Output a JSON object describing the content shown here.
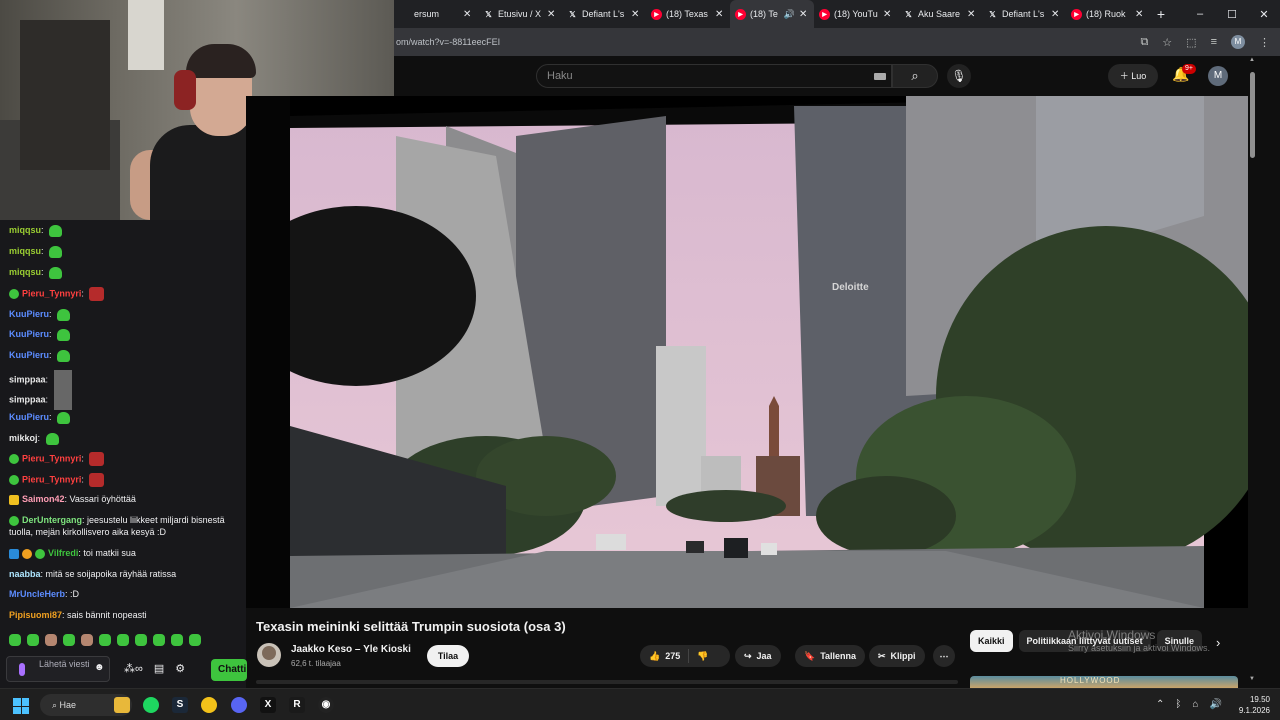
{
  "browser": {
    "tabs": [
      {
        "label": "ersum",
        "icon": "page-icon",
        "active": false
      },
      {
        "label": "Etusivu / X",
        "icon": "x-icon",
        "active": false
      },
      {
        "label": "Defiant L's",
        "icon": "x-icon",
        "active": false
      },
      {
        "label": "(18) Texas",
        "icon": "youtube-icon",
        "active": false
      },
      {
        "label": "(18) Te",
        "icon": "youtube-icon",
        "active": true
      },
      {
        "label": "(18) YouTu",
        "icon": "youtube-icon",
        "active": false
      },
      {
        "label": "Aku Saare",
        "icon": "x-icon",
        "active": false
      },
      {
        "label": "Defiant L's",
        "icon": "x-icon",
        "active": false
      },
      {
        "label": "(18) Ruok",
        "icon": "youtube-icon",
        "active": false
      }
    ],
    "new_tab": "+",
    "window_controls": [
      "–",
      "☐",
      "✕"
    ],
    "url": "om/watch?v=-8811eecFEI",
    "profile_initial": "M"
  },
  "youtube": {
    "search_placeholder": "Haku",
    "create_label": "Luo",
    "notifications_badge": "9+",
    "user_initial": "M",
    "video": {
      "title": "Texasin meininki selittää Trumpin suosiota (osa 3)",
      "overlay_text": "Deloitte",
      "bottom_text": "Aktivoi Windows"
    },
    "channel": {
      "name": "Jaakko Keso – Yle Kioski",
      "subscribers": "62,6 t. tilaajaa",
      "subscribe_label": "Tilaa"
    },
    "actions": {
      "likes": "275",
      "share": "Jaa",
      "save": "Tallenna",
      "clip": "Klippi"
    },
    "chips": [
      "Kaikki",
      "Politiikkaan liittyvät uutiset",
      "Sinulle"
    ],
    "thumbnail_text": "HOLLYWOOD"
  },
  "windows_watermark": {
    "line1": "Aktivoi Windows",
    "line2": "Siirry asetuksiin ja aktivoi Windows."
  },
  "chat": {
    "messages": [
      {
        "user": "miqqsu",
        "text": "",
        "color": "#9acd32"
      },
      {
        "user": "miqqsu",
        "text": "",
        "color": "#9acd32"
      },
      {
        "user": "miqqsu",
        "text": "",
        "color": "#9acd32"
      },
      {
        "user": "Pieru_Tynnyri",
        "text": "",
        "color": "#ff4040"
      },
      {
        "user": "KuuPieru",
        "text": "",
        "color": "#5c8cff"
      },
      {
        "user": "KuuPieru",
        "text": "",
        "color": "#5c8cff"
      },
      {
        "user": "KuuPieru",
        "text": "",
        "color": "#5c8cff"
      },
      {
        "user": "simppaa",
        "text": "",
        "color": "#e8e8e8"
      },
      {
        "user": "simppaa",
        "text": "",
        "color": "#e8e8e8"
      },
      {
        "user": "KuuPieru",
        "text": "",
        "color": "#5c8cff"
      },
      {
        "user": "mikkoj",
        "text": "",
        "color": "#e8e8e8"
      },
      {
        "user": "Pieru_Tynnyri",
        "text": "",
        "color": "#ff4040"
      },
      {
        "user": "Pieru_Tynnyri",
        "text": "",
        "color": "#ff4040"
      },
      {
        "user": "Saimon42",
        "text": "Vassari öyhöttää",
        "color": "#ff9eb5"
      },
      {
        "user": "DerUntergang",
        "text": "jeesustelu liikkeet miljardi bisnestä tuolla, mejän kirkollisvero aika kesyä :D",
        "color": "#7ee37e"
      },
      {
        "user": "Vilfredi",
        "text": "toi matkii sua",
        "color": "#3ec43e"
      },
      {
        "user": "naabba",
        "text": "mitä se soijapoika räyhää ratissa",
        "color": "#aee6ff"
      },
      {
        "user": "MrUncleHerb",
        "text": ":D",
        "color": "#5c8cff"
      },
      {
        "user": "Pipisuomi87",
        "text": "sais bännit nopeasti",
        "color": "#f0a020"
      }
    ],
    "input_placeholder": "Lähetä viesti",
    "chat_button": "Chatti"
  },
  "taskbar": {
    "search_label": "Hae",
    "time": "19.50",
    "date": "9.1.2026"
  },
  "colors": {
    "youtube_bg": "#0f0f0f",
    "chat_bg": "#18181b",
    "twitch_green": "#3ec43e",
    "youtube_red": "#ff0033"
  }
}
